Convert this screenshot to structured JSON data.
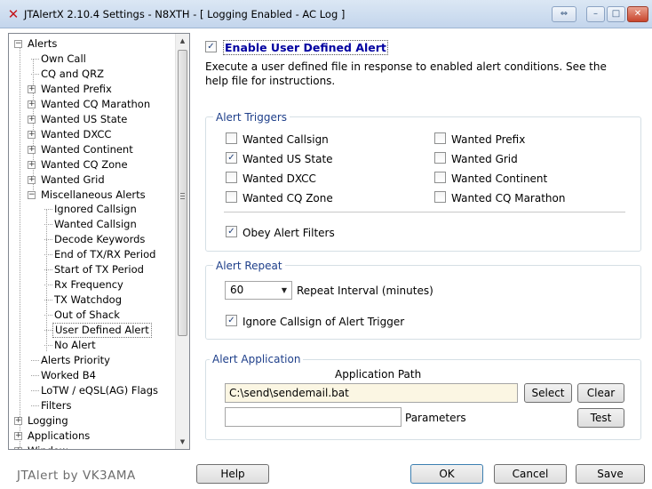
{
  "window": {
    "app_icon": "x-logo-icon",
    "title": "JTAlertX 2.10.4 Settings  -  N8XTH  -  [ Logging Enabled - AC Log ]",
    "controls": {
      "restore": "⇔",
      "minimize": "–",
      "maximize": "□",
      "close": "✕"
    }
  },
  "tree": {
    "items": [
      {
        "label": "Alerts",
        "expander": "−"
      },
      {
        "label": "Own Call",
        "expander": ""
      },
      {
        "label": "CQ and QRZ",
        "expander": ""
      },
      {
        "label": "Wanted Prefix",
        "expander": "+"
      },
      {
        "label": "Wanted CQ Marathon",
        "expander": "+"
      },
      {
        "label": "Wanted US State",
        "expander": "+"
      },
      {
        "label": "Wanted DXCC",
        "expander": "+"
      },
      {
        "label": "Wanted Continent",
        "expander": "+"
      },
      {
        "label": "Wanted CQ Zone",
        "expander": "+"
      },
      {
        "label": "Wanted Grid",
        "expander": "+"
      },
      {
        "label": "Miscellaneous Alerts",
        "expander": "−"
      },
      {
        "label": "Ignored Callsign",
        "expander": ""
      },
      {
        "label": "Wanted Callsign",
        "expander": ""
      },
      {
        "label": "Decode Keywords",
        "expander": ""
      },
      {
        "label": "End of TX/RX Period",
        "expander": ""
      },
      {
        "label": "Start of TX Period",
        "expander": ""
      },
      {
        "label": "Rx Frequency",
        "expander": ""
      },
      {
        "label": "TX Watchdog",
        "expander": ""
      },
      {
        "label": "Out of Shack",
        "expander": ""
      },
      {
        "label": "User Defined Alert",
        "expander": ""
      },
      {
        "label": "No Alert",
        "expander": ""
      },
      {
        "label": "Alerts Priority",
        "expander": ""
      },
      {
        "label": "Worked B4",
        "expander": ""
      },
      {
        "label": "LoTW / eQSL(AG) Flags",
        "expander": ""
      },
      {
        "label": "Filters",
        "expander": ""
      },
      {
        "label": "Logging",
        "expander": "+"
      },
      {
        "label": "Applications",
        "expander": "+"
      },
      {
        "label": "Window",
        "expander": "+"
      }
    ],
    "selected": "User Defined Alert"
  },
  "enable": {
    "label": "Enable User Defined Alert",
    "checked": true,
    "mark": "✓"
  },
  "description": "Execute a user defined file in response to enabled alert conditions. See the help file for instructions.",
  "triggers": {
    "title": "Alert Triggers",
    "left": [
      {
        "label": "Wanted Callsign",
        "checked": false
      },
      {
        "label": "Wanted US State",
        "checked": true
      },
      {
        "label": "Wanted DXCC",
        "checked": false
      },
      {
        "label": "Wanted CQ Zone",
        "checked": false
      }
    ],
    "right": [
      {
        "label": "Wanted Prefix",
        "checked": false
      },
      {
        "label": "Wanted Grid",
        "checked": false
      },
      {
        "label": "Wanted Continent",
        "checked": false
      },
      {
        "label": "Wanted CQ Marathon",
        "checked": false
      }
    ],
    "obey": {
      "label": "Obey Alert Filters",
      "checked": true
    }
  },
  "repeat": {
    "title": "Alert Repeat",
    "interval_value": "60",
    "interval_label": "Repeat Interval (minutes)",
    "ignore": {
      "label": "Ignore Callsign of Alert Trigger",
      "checked": true
    }
  },
  "application": {
    "title": "Alert Application",
    "path_header": "Application Path",
    "path_value": "C:\\send\\sendemail.bat",
    "params_value": "",
    "params_label": "Parameters",
    "select_btn": "Select",
    "clear_btn": "Clear",
    "test_btn": "Test"
  },
  "footer": {
    "brand": "JTAlert by VK3AMA",
    "help": "Help",
    "ok": "OK",
    "cancel": "Cancel",
    "save": "Save"
  },
  "colors": {
    "accent_text": "#0000a0",
    "group_title": "#1e3f8a",
    "path_bg": "#fbf6e3"
  }
}
